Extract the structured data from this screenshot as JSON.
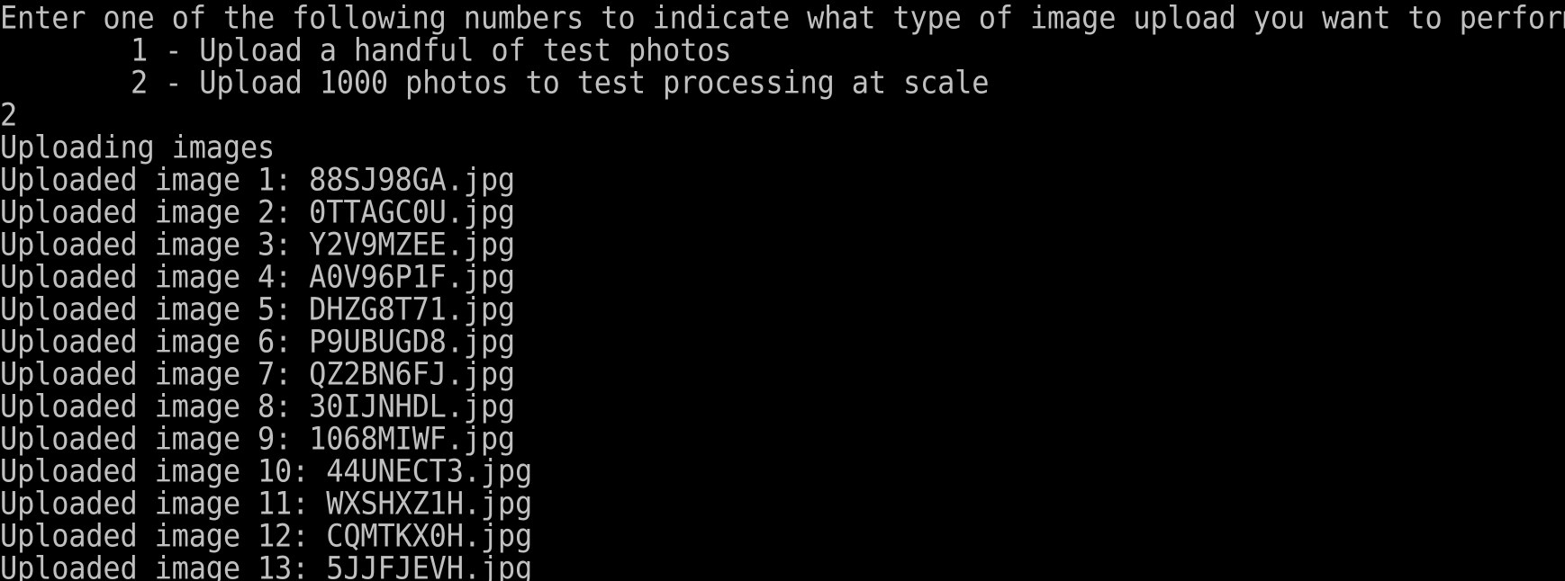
{
  "terminal": {
    "prompt": "Enter one of the following numbers to indicate what type of image upload you want to perform:",
    "options": [
      "1 - Upload a handful of test photos",
      "2 - Upload 1000 photos to test processing at scale"
    ],
    "user_input": "2",
    "status": "Uploading images",
    "uploads": [
      "Uploaded image 1: 88SJ98GA.jpg",
      "Uploaded image 2: 0TTAGC0U.jpg",
      "Uploaded image 3: Y2V9MZEE.jpg",
      "Uploaded image 4: A0V96P1F.jpg",
      "Uploaded image 5: DHZG8T71.jpg",
      "Uploaded image 6: P9UBUGD8.jpg",
      "Uploaded image 7: QZ2BN6FJ.jpg",
      "Uploaded image 8: 30IJNHDL.jpg",
      "Uploaded image 9: 1068MIWF.jpg",
      "Uploaded image 10: 44UNECT3.jpg",
      "Uploaded image 11: WXSHXZ1H.jpg",
      "Uploaded image 12: CQMTKX0H.jpg",
      "Uploaded image 13: 5JJFJEVH.jpg"
    ]
  },
  "colors": {
    "background": "#000000",
    "text": "#c0c0c0"
  }
}
